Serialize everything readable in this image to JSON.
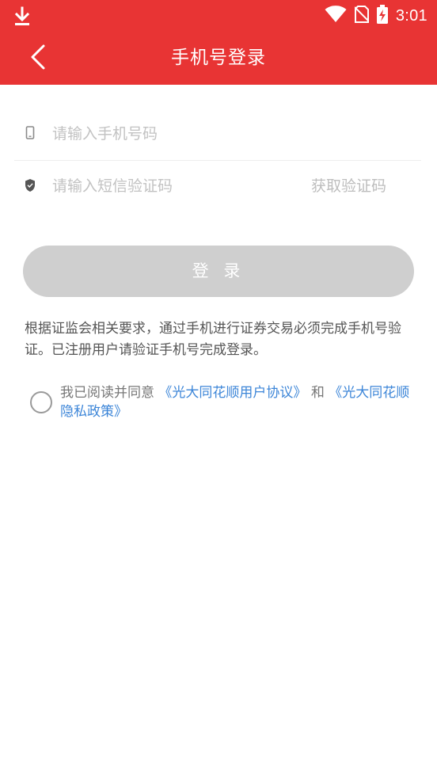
{
  "status_bar": {
    "time": "3:01",
    "icons": [
      "download-icon",
      "wifi-icon",
      "no-sim-icon",
      "battery-charging-icon"
    ]
  },
  "header": {
    "title": "手机号登录",
    "back_icon": "chevron-left-icon"
  },
  "form": {
    "phone": {
      "placeholder": "请输入手机号码",
      "value": "",
      "icon": "phone-icon"
    },
    "code": {
      "placeholder": "请输入短信验证码",
      "value": "",
      "icon": "shield-icon",
      "get_code_label": "获取验证码"
    },
    "login_label": "登 录"
  },
  "notice": "根据证监会相关要求，通过手机进行证券交易必须完成手机号验证。已注册用户请验证手机号完成登录。",
  "agreement": {
    "prefix": "我已阅读并同意",
    "link1": "《光大同花顺用户协议》",
    "connector": "和",
    "link2": "《光大同花顺隐私政策》",
    "checked": false
  },
  "colors": {
    "brand_red": "#e83434",
    "link_blue": "#3d86d8",
    "button_disabled": "#cfcfcf"
  }
}
